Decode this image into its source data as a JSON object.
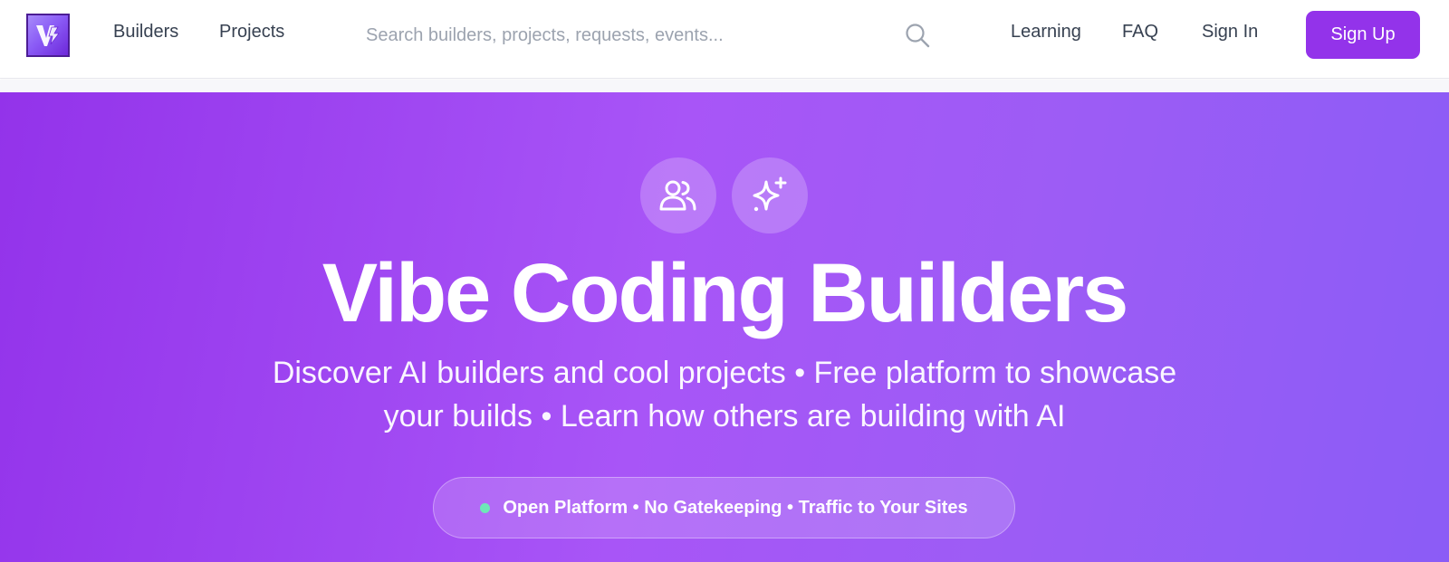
{
  "nav": {
    "links": [
      {
        "label": "Builders"
      },
      {
        "label": "Projects"
      }
    ],
    "search": {
      "placeholder": "Search builders, projects, requests, events..."
    },
    "right_links": [
      {
        "label": "Learning"
      },
      {
        "label": "FAQ"
      },
      {
        "label": "Sign In"
      }
    ],
    "signup_label": "Sign Up"
  },
  "hero": {
    "icons": [
      "users-icon",
      "sparkles-icon"
    ],
    "title": "Vibe Coding Builders",
    "subtitle_line1": "Discover AI builders and cool projects • Free platform to showcase",
    "subtitle_line2": "your builds • Learn how others are building with AI",
    "pill_text": "Open Platform • No Gatekeeping • Traffic to Your Sites"
  },
  "colors": {
    "brand": "#9333ea",
    "hero_gradient_start": "#9333ea",
    "hero_gradient_end": "#8b5cf6",
    "pill_dot": "#6ee7b7"
  }
}
